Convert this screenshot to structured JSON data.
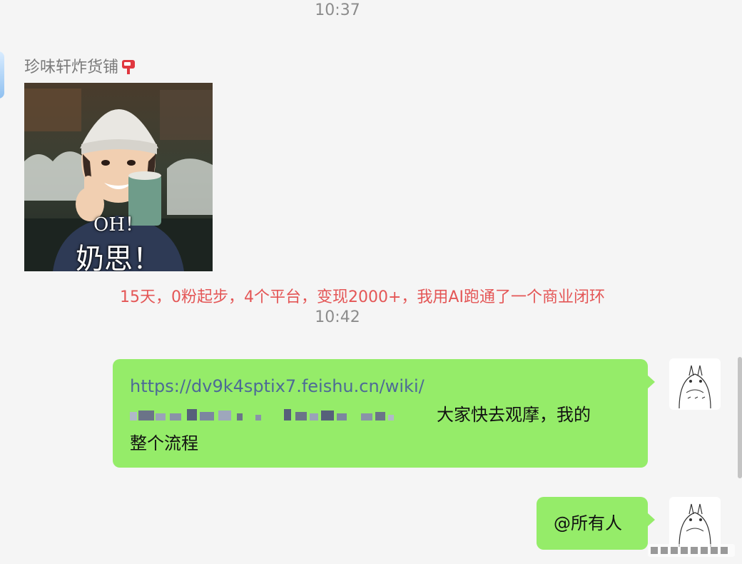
{
  "chat": {
    "timestamps": [
      "10:37",
      "10:42"
    ],
    "sender_name": "珍味轩炸货铺",
    "sticker": {
      "caption_small": "OH！",
      "caption_large": "奶思！"
    },
    "system_message": "15天，0粉起步，4个平台，变现2000+，我用AI跑通了一个商业闭环",
    "messages": [
      {
        "link": "https://dv9k4sptix7.feishu.cn/wiki/",
        "text_line1": "大家快去观摩，我的",
        "text_line2": "整个流程"
      },
      {
        "text": "@所有人"
      }
    ]
  },
  "icons": {
    "mailbox": "mailbox-icon",
    "avatar": "totoro-avatar",
    "watermark": "weibo-watermark"
  },
  "colors": {
    "bubble": "#95ec69",
    "system_text": "#e45656",
    "link": "#4d6a96",
    "background": "#f5f5f5"
  }
}
